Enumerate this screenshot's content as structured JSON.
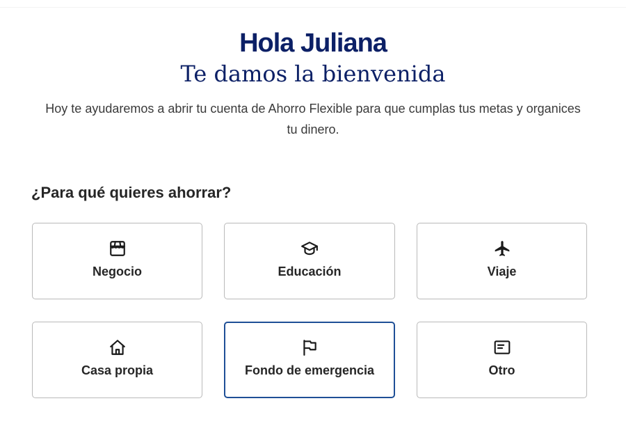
{
  "header": {
    "greeting": "Hola Juliana",
    "welcome": "Te damos la bienvenida",
    "intro": "Hoy te ayudaremos a abrir tu cuenta de Ahorro Flexible para que cumplas tus metas y organices tu dinero."
  },
  "savings_goal": {
    "question": "¿Para qué quieres ahorrar?",
    "selected": "Fondo de emergencia",
    "options": [
      {
        "label": "Negocio",
        "icon": "storefront-icon"
      },
      {
        "label": "Educación",
        "icon": "graduation-cap-icon"
      },
      {
        "label": "Viaje",
        "icon": "airplane-icon"
      },
      {
        "label": "Casa propia",
        "icon": "house-icon"
      },
      {
        "label": "Fondo de emergencia",
        "icon": "flag-icon"
      },
      {
        "label": "Otro",
        "icon": "card-icon"
      }
    ]
  },
  "colors": {
    "brand_navy": "#0c2066",
    "selected_border": "#1e4f96",
    "card_border": "#b9b9b9",
    "text": "#262626"
  }
}
